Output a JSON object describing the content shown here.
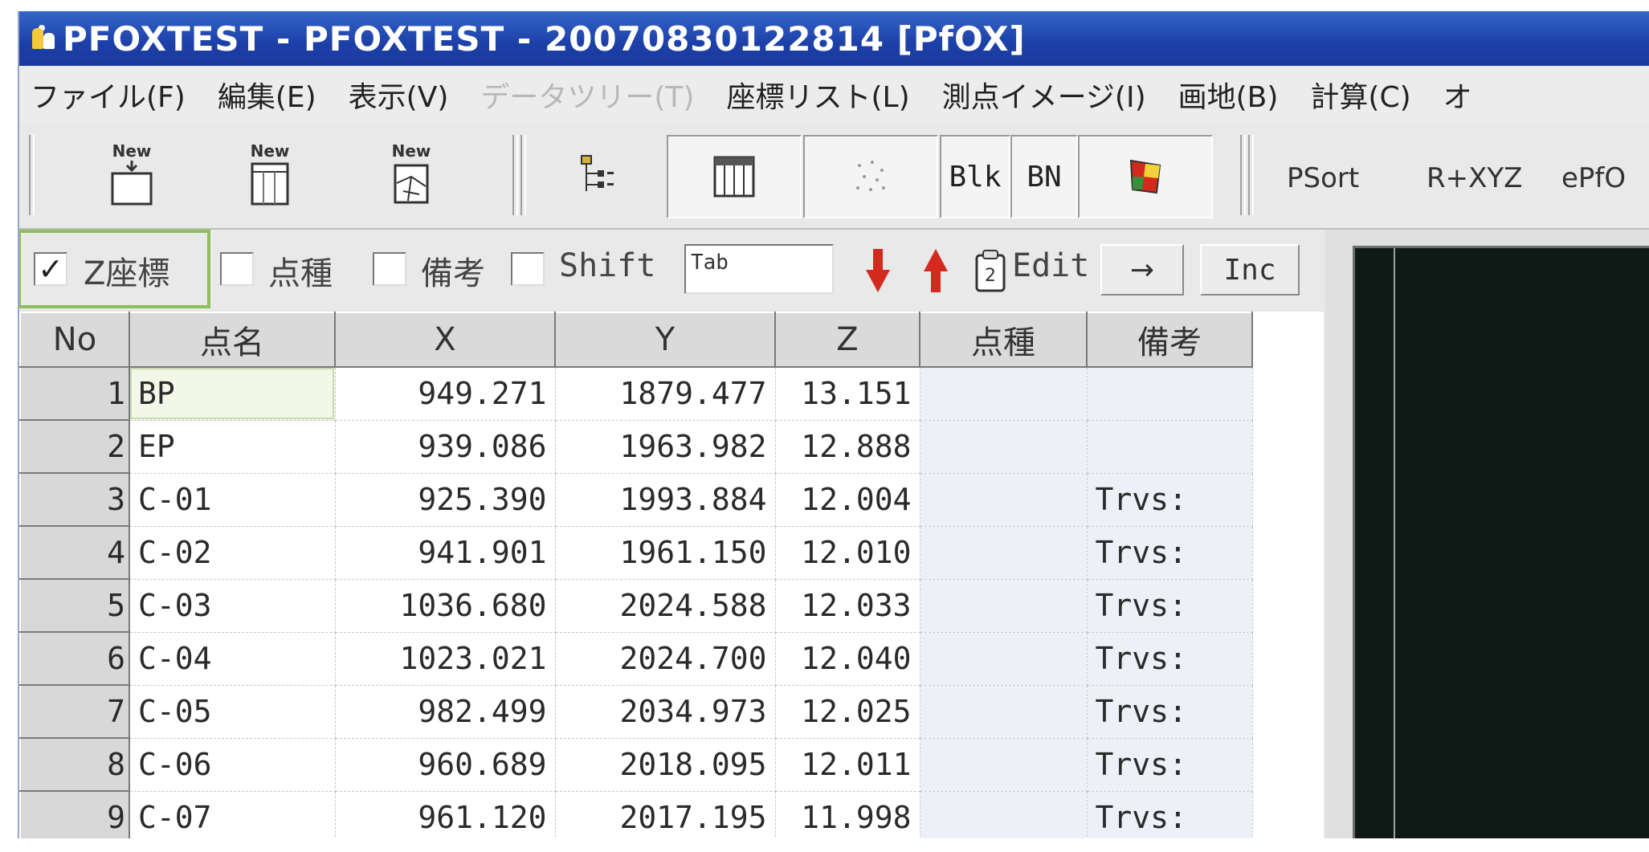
{
  "window": {
    "title": "PFOXTEST - PFOXTEST - 20070830122814 [PfOX]"
  },
  "menu": [
    {
      "label": "ファイル(F)",
      "disabled": false
    },
    {
      "label": "編集(E)",
      "disabled": false
    },
    {
      "label": "表示(V)",
      "disabled": false
    },
    {
      "label": "データツリー(T)",
      "disabled": true
    },
    {
      "label": "座標リスト(L)",
      "disabled": false
    },
    {
      "label": "測点イメージ(I)",
      "disabled": false
    },
    {
      "label": "画地(B)",
      "disabled": false
    },
    {
      "label": "計算(C)",
      "disabled": false
    },
    {
      "label": "オ",
      "disabled": false
    }
  ],
  "toolbar": {
    "new_label": "New",
    "blk_label": "Blk",
    "bn_label": "BN",
    "psort_label": "PSort",
    "rxyz_label": "R+XYZ",
    "epf_label": "ePfO"
  },
  "options": {
    "z_coord": {
      "label": "Z座標",
      "checked": true
    },
    "point_type": {
      "label": "点種",
      "checked": false
    },
    "remarks": {
      "label": "備考",
      "checked": false
    },
    "shift": {
      "label": "Shift",
      "checked": false
    },
    "tab_input_value": "Tab",
    "edit_label": "Edit",
    "arrow_label": "→",
    "inc_label": "Inc"
  },
  "grid": {
    "columns": [
      "No",
      "点名",
      "X",
      "Y",
      "Z",
      "点種",
      "備考"
    ],
    "rows": [
      {
        "no": "1",
        "name": "BP",
        "x": "949.271",
        "y": "1879.477",
        "z": "13.151",
        "type": "",
        "remark": ""
      },
      {
        "no": "2",
        "name": "EP",
        "x": "939.086",
        "y": "1963.982",
        "z": "12.888",
        "type": "",
        "remark": ""
      },
      {
        "no": "3",
        "name": "C-01",
        "x": "925.390",
        "y": "1993.884",
        "z": "12.004",
        "type": "",
        "remark": "Trvs:"
      },
      {
        "no": "4",
        "name": "C-02",
        "x": "941.901",
        "y": "1961.150",
        "z": "12.010",
        "type": "",
        "remark": "Trvs:"
      },
      {
        "no": "5",
        "name": "C-03",
        "x": "1036.680",
        "y": "2024.588",
        "z": "12.033",
        "type": "",
        "remark": "Trvs:"
      },
      {
        "no": "6",
        "name": "C-04",
        "x": "1023.021",
        "y": "2024.700",
        "z": "12.040",
        "type": "",
        "remark": "Trvs:"
      },
      {
        "no": "7",
        "name": "C-05",
        "x": "982.499",
        "y": "2034.973",
        "z": "12.025",
        "type": "",
        "remark": "Trvs:"
      },
      {
        "no": "8",
        "name": "C-06",
        "x": "960.689",
        "y": "2018.095",
        "z": "12.011",
        "type": "",
        "remark": "Trvs:"
      },
      {
        "no": "9",
        "name": "C-07",
        "x": "961.120",
        "y": "2017.195",
        "z": "11.998",
        "type": "",
        "remark": "Trvs:"
      }
    ]
  },
  "colors": {
    "titlebar": "#1c3fa8",
    "highlight": "#8fbf5a",
    "red_arrow": "#d42a1e",
    "dark_view": "#0f1a17"
  }
}
